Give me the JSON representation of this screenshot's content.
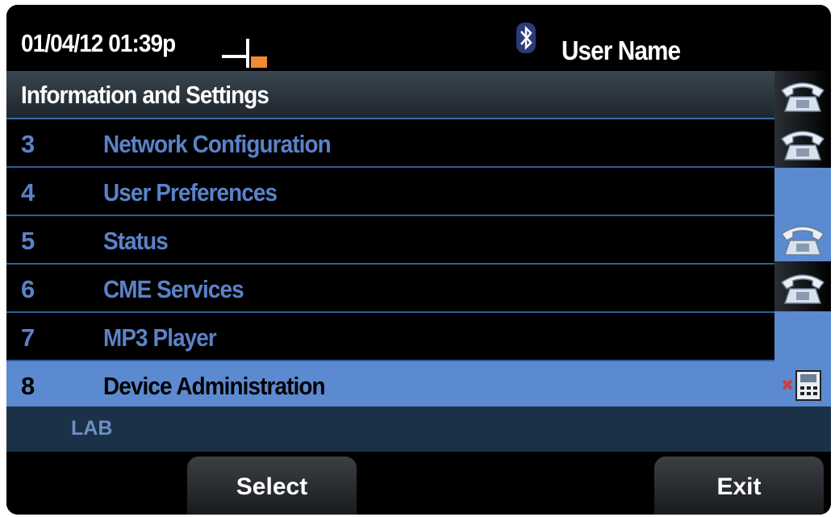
{
  "status": {
    "datetime": "01/04/12 01:39p",
    "user_name": "User Name"
  },
  "menu": {
    "title": "Information and Settings",
    "items": [
      {
        "num": "3",
        "label": "Network Configuration"
      },
      {
        "num": "4",
        "label": "User Preferences"
      },
      {
        "num": "5",
        "label": "Status"
      },
      {
        "num": "6",
        "label": "CME Services"
      },
      {
        "num": "7",
        "label": "MP3 Player"
      },
      {
        "num": "8",
        "label": "Device Administration",
        "selected": true
      }
    ]
  },
  "footer": {
    "lab_label": "LAB"
  },
  "softkeys": {
    "select_label": "Select",
    "exit_label": "Exit"
  },
  "icons": {
    "handset": "handset-status-icon",
    "bluetooth": "bluetooth-icon",
    "line": "phone-line-icon",
    "unregistered": "line-unregistered-icon"
  },
  "colors": {
    "accent": "#5b8ad0",
    "menu_text": "#5b82c8",
    "status_orange": "#f28a2e"
  }
}
